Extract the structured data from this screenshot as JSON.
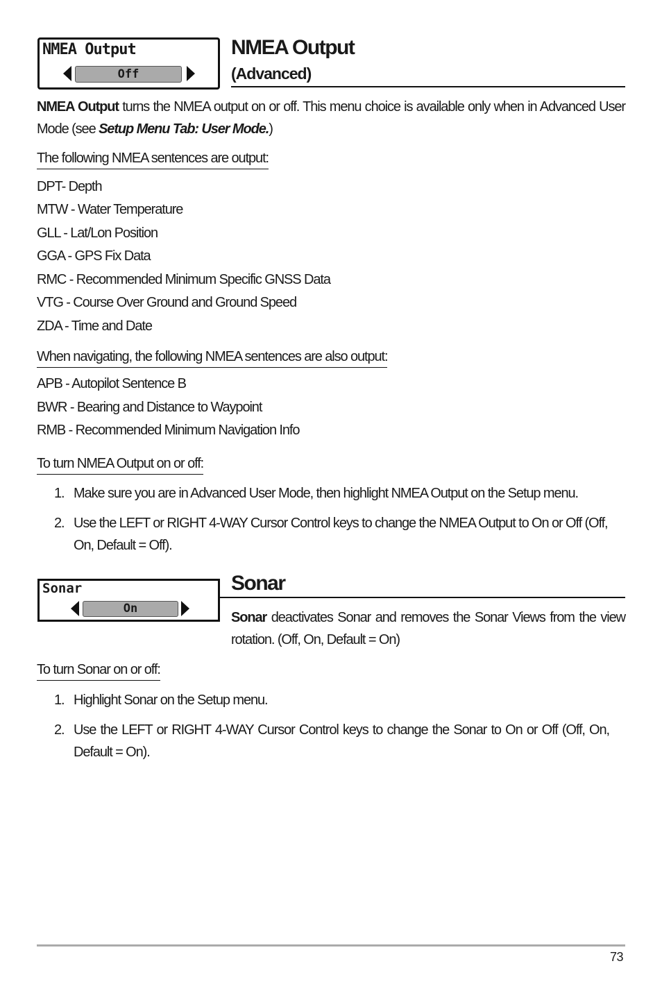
{
  "nmea": {
    "widget": {
      "title": "NMEA Output",
      "value": "Off"
    },
    "title": "NMEA Output",
    "subtitle": "(Advanced)",
    "intro_bold": "NMEA Output",
    "intro_text": " turns the NMEA output on or off.  This menu choice is available only when in Advanced User Mode (see ",
    "intro_italic": "Setup Menu Tab: User Mode.",
    "intro_end": ")",
    "sentences_heading": "The following NMEA sentences are output:",
    "sentences": [
      "DPT- Depth",
      "MTW - Water Temperature",
      "GLL - Lat/Lon Position",
      "GGA - GPS Fix Data",
      "RMC - Recommended Minimum Specific GNSS Data",
      "VTG - Course Over Ground and Ground Speed",
      "ZDA - Time and Date"
    ],
    "nav_heading": "When navigating, the following NMEA sentences are also output:",
    "nav_sentences": [
      "APB - Autopilot Sentence B",
      "BWR - Bearing and Distance to Waypoint",
      "RMB - Recommended Minimum Navigation Info"
    ],
    "howto_heading": "To turn NMEA Output on or off:",
    "steps": [
      {
        "num": "1.",
        "text": "Make sure you are in Advanced User Mode, then highlight NMEA Output on the Setup menu."
      },
      {
        "num": "2.",
        "text": "Use the LEFT or RIGHT 4-WAY Cursor Control keys to change the NMEA Output to On or Off (Off, On, Default = Off)."
      }
    ]
  },
  "sonar": {
    "widget": {
      "title": "Sonar",
      "value": "On"
    },
    "title": "Sonar",
    "intro_bold": "Sonar",
    "intro_text": " deactivates Sonar and removes the Sonar Views from the view rotation. (Off, On, Default = On)",
    "howto_heading": "To turn Sonar on or off:",
    "steps": [
      {
        "num": "1.",
        "text": "Highlight Sonar on the Setup menu."
      },
      {
        "num": "2.",
        "text": "Use the LEFT or RIGHT 4-WAY Cursor Control keys to change the Sonar to On or Off (Off, On, Default = On)."
      }
    ]
  },
  "footer": {
    "page_number": "73"
  }
}
